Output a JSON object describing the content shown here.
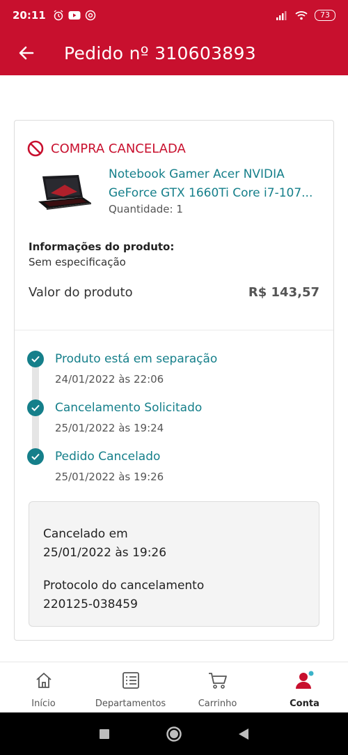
{
  "status_bar": {
    "time": "20:11",
    "battery": "73"
  },
  "header": {
    "title": "Pedido nº 310603893"
  },
  "order": {
    "status": "COMPRA CANCELADA",
    "product_name_line1": "Notebook Gamer Acer NVIDIA",
    "product_name_line2": "GeForce GTX 1660Ti Core i7-107...",
    "quantity": "Quantidade: 1",
    "info_label": "Informações do produto:",
    "info_value": "Sem especificação",
    "price_label": "Valor do produto",
    "price_value": "R$ 143,57"
  },
  "timeline": [
    {
      "title": "Produto está em separação",
      "date": "24/01/2022 às 22:06"
    },
    {
      "title": "Cancelamento Solicitado",
      "date": "25/01/2022 às 19:24"
    },
    {
      "title": "Pedido Cancelado",
      "date": "25/01/2022 às 19:26"
    }
  ],
  "cancel_info": {
    "cancelled_at_label": "Cancelado em",
    "cancelled_at_value": "25/01/2022 às 19:26",
    "protocol_label": "Protocolo do cancelamento",
    "protocol_value": "220125-038459"
  },
  "bottom_nav": {
    "items": [
      {
        "label": "Início",
        "icon": "home-icon"
      },
      {
        "label": "Departamentos",
        "icon": "list-icon"
      },
      {
        "label": "Carrinho",
        "icon": "cart-icon"
      },
      {
        "label": "Conta",
        "icon": "user-icon"
      }
    ],
    "active": "Conta"
  },
  "colors": {
    "brand_red": "#c8102e",
    "accent_teal": "#157f8a"
  }
}
